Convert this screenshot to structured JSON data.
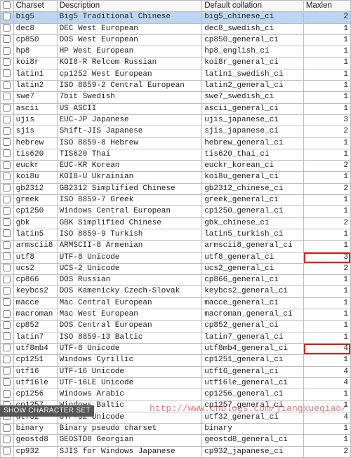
{
  "columns": {
    "charset": "Charset",
    "description": "Description",
    "collation": "Default collation",
    "maxlen": "Maxlen"
  },
  "rows": [
    {
      "charset": "big5",
      "description": "Big5 Traditional Chinese",
      "collation": "big5_chinese_ci",
      "maxlen": "2",
      "selected": true
    },
    {
      "charset": "dec8",
      "description": "DEC West European",
      "collation": "dec8_swedish_ci",
      "maxlen": "1"
    },
    {
      "charset": "cp850",
      "description": "DOS West European",
      "collation": "cp850_general_ci",
      "maxlen": "1"
    },
    {
      "charset": "hp8",
      "description": "HP West European",
      "collation": "hp8_english_ci",
      "maxlen": "1"
    },
    {
      "charset": "koi8r",
      "description": "KOI8-R Relcom Russian",
      "collation": "koi8r_general_ci",
      "maxlen": "1"
    },
    {
      "charset": "latin1",
      "description": "cp1252 West European",
      "collation": "latin1_swedish_ci",
      "maxlen": "1"
    },
    {
      "charset": "latin2",
      "description": "ISO 8859-2 Central European",
      "collation": "latin2_general_ci",
      "maxlen": "1"
    },
    {
      "charset": "swe7",
      "description": "7bit Swedish",
      "collation": "swe7_swedish_ci",
      "maxlen": "1"
    },
    {
      "charset": "ascii",
      "description": "US ASCII",
      "collation": "ascii_general_ci",
      "maxlen": "1"
    },
    {
      "charset": "ujis",
      "description": "EUC-JP Japanese",
      "collation": "ujis_japanese_ci",
      "maxlen": "3"
    },
    {
      "charset": "sjis",
      "description": "Shift-JIS Japanese",
      "collation": "sjis_japanese_ci",
      "maxlen": "2"
    },
    {
      "charset": "hebrew",
      "description": "ISO 8859-8 Hebrew",
      "collation": "hebrew_general_ci",
      "maxlen": "1"
    },
    {
      "charset": "tis620",
      "description": "TIS620 Thai",
      "collation": "tis620_thai_ci",
      "maxlen": "1"
    },
    {
      "charset": "euckr",
      "description": "EUC-KR Korean",
      "collation": "euckr_korean_ci",
      "maxlen": "2"
    },
    {
      "charset": "koi8u",
      "description": "KOI8-U Ukrainian",
      "collation": "koi8u_general_ci",
      "maxlen": "1"
    },
    {
      "charset": "gb2312",
      "description": "GB2312 Simplified Chinese",
      "collation": "gb2312_chinese_ci",
      "maxlen": "2"
    },
    {
      "charset": "greek",
      "description": "ISO 8859-7 Greek",
      "collation": "greek_general_ci",
      "maxlen": "1"
    },
    {
      "charset": "cp1250",
      "description": "Windows Central European",
      "collation": "cp1250_general_ci",
      "maxlen": "1"
    },
    {
      "charset": "gbk",
      "description": "GBK Simplified Chinese",
      "collation": "gbk_chinese_ci",
      "maxlen": "2"
    },
    {
      "charset": "latin5",
      "description": "ISO 8859-9 Turkish",
      "collation": "latin5_turkish_ci",
      "maxlen": "1"
    },
    {
      "charset": "armscii8",
      "description": "ARMSCII-8 Armenian",
      "collation": "armscii8_general_ci",
      "maxlen": "1"
    },
    {
      "charset": "utf8",
      "description": "UTF-8 Unicode",
      "collation": "utf8_general_ci",
      "maxlen": "3",
      "highlight": true
    },
    {
      "charset": "ucs2",
      "description": "UCS-2 Unicode",
      "collation": "ucs2_general_ci",
      "maxlen": "2"
    },
    {
      "charset": "cp866",
      "description": "DOS Russian",
      "collation": "cp866_general_ci",
      "maxlen": "1"
    },
    {
      "charset": "keybcs2",
      "description": "DOS Kamenicky Czech-Slovak",
      "collation": "keybcs2_general_ci",
      "maxlen": "1"
    },
    {
      "charset": "macce",
      "description": "Mac Central European",
      "collation": "macce_general_ci",
      "maxlen": "1"
    },
    {
      "charset": "macroman",
      "description": "Mac West European",
      "collation": "macroman_general_ci",
      "maxlen": "1"
    },
    {
      "charset": "cp852",
      "description": "DOS Central European",
      "collation": "cp852_general_ci",
      "maxlen": "1"
    },
    {
      "charset": "latin7",
      "description": "ISO 8859-13 Baltic",
      "collation": "latin7_general_ci",
      "maxlen": "1"
    },
    {
      "charset": "utf8mb4",
      "description": "UTF-8 Unicode",
      "collation": "utf8mb4_general_ci",
      "maxlen": "4",
      "highlight": true
    },
    {
      "charset": "cp1251",
      "description": "Windows Cyrillic",
      "collation": "cp1251_general_ci",
      "maxlen": "1"
    },
    {
      "charset": "utf16",
      "description": "UTF-16 Unicode",
      "collation": "utf16_general_ci",
      "maxlen": "4"
    },
    {
      "charset": "utf16le",
      "description": "UTF-16LE Unicode",
      "collation": "utf16le_general_ci",
      "maxlen": "4"
    },
    {
      "charset": "cp1256",
      "description": "Windows Arabic",
      "collation": "cp1256_general_ci",
      "maxlen": "1"
    },
    {
      "charset": "cp1257",
      "description": "Windows Baltic",
      "collation": "cp1257_general_ci",
      "maxlen": "1"
    },
    {
      "charset": "utf32",
      "description": "UTF-32 Unicode",
      "collation": "utf32_general_ci",
      "maxlen": "4"
    },
    {
      "charset": "binary",
      "description": "Binary pseudo charset",
      "collation": "binary",
      "maxlen": "1"
    },
    {
      "charset": "geostd8",
      "description": "GEOSTD8 Georgian",
      "collation": "geostd8_general_ci",
      "maxlen": "1"
    },
    {
      "charset": "cp932",
      "description": "SJIS for Windows Japanese",
      "collation": "cp932_japanese_ci",
      "maxlen": "2"
    }
  ],
  "status_text": "SHOW CHARACTER SET",
  "watermark": "http://www.cnblogs.com/jiangxueqiao/"
}
